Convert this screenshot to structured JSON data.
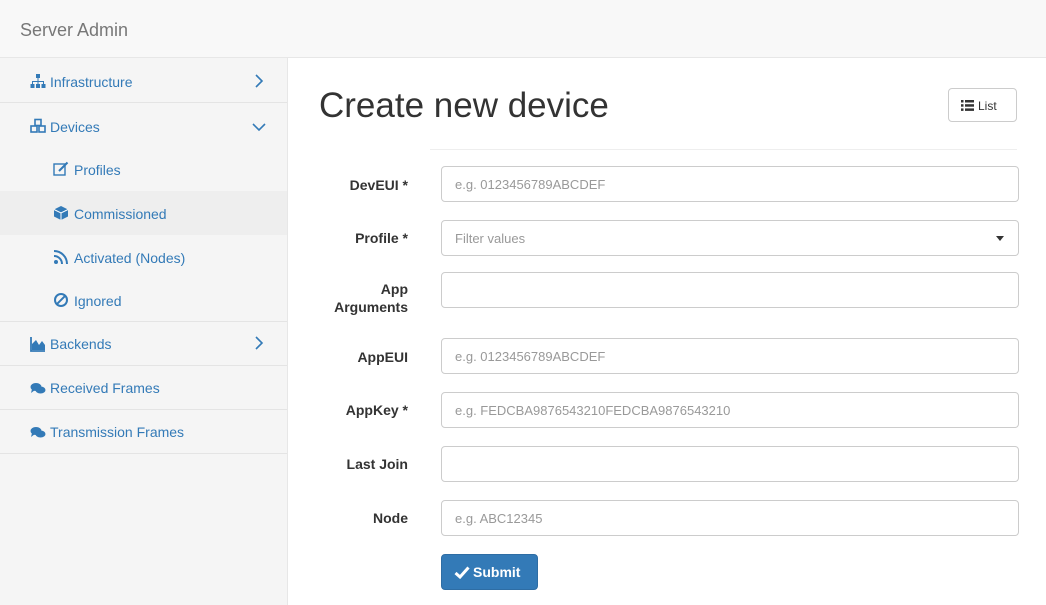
{
  "app": {
    "title": "Server Admin"
  },
  "sidebar": {
    "items": [
      {
        "label": "Infrastructure",
        "icon": "sitemap-icon"
      },
      {
        "label": "Devices",
        "icon": "cubes-icon"
      },
      {
        "label": "Profiles",
        "icon": "edit-icon"
      },
      {
        "label": "Commissioned",
        "icon": "cube-icon"
      },
      {
        "label": "Activated (Nodes)",
        "icon": "rss-icon"
      },
      {
        "label": "Ignored",
        "icon": "ban-icon"
      },
      {
        "label": "Backends",
        "icon": "area-chart-icon"
      },
      {
        "label": "Received Frames",
        "icon": "comments-icon"
      },
      {
        "label": "Transmission Frames",
        "icon": "comments-icon"
      }
    ]
  },
  "page": {
    "title": "Create new device",
    "list_button": "List"
  },
  "form": {
    "fields": [
      {
        "label": "DevEUI *",
        "placeholder": "e.g. 0123456789ABCDEF"
      },
      {
        "label": "Profile *",
        "placeholder": "Filter values"
      },
      {
        "label_line1": "App",
        "label_line2": "Arguments",
        "placeholder": ""
      },
      {
        "label": "AppEUI",
        "placeholder": "e.g. 0123456789ABCDEF"
      },
      {
        "label": "AppKey *",
        "placeholder": "e.g. FEDCBA9876543210FEDCBA9876543210"
      },
      {
        "label": "Last Join",
        "placeholder": ""
      },
      {
        "label": "Node",
        "placeholder": "e.g. ABC12345"
      }
    ],
    "submit_label": "Submit"
  },
  "colors": {
    "link": "#337ab7",
    "primary_button": "#337ab7",
    "sidebar_bg": "#f5f5f5"
  }
}
